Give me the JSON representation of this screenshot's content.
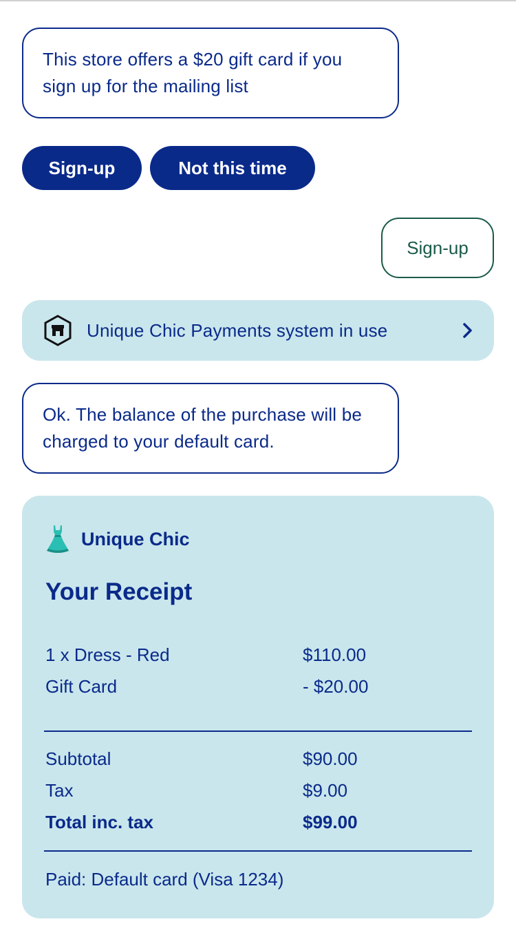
{
  "messages": {
    "offer_text": "This store offers a $20 gift card if you sign up for the mailing list",
    "balance_text": "Ok. The balance of the purchase will be charged to your default card."
  },
  "quick_replies": {
    "signup_label": "Sign-up",
    "decline_label": "Not this time"
  },
  "user_reply": {
    "text": "Sign-up"
  },
  "payment_banner": {
    "text": "Unique Chic Payments system in use",
    "icon": "store-icon"
  },
  "receipt": {
    "merchant_icon": "dress-emoji",
    "merchant_name": "Unique Chic",
    "title": "Your Receipt",
    "items": [
      {
        "label": "1 x Dress - Red",
        "value": "$110.00"
      },
      {
        "label": "Gift Card",
        "value": "- $20.00"
      }
    ],
    "totals": [
      {
        "label": "Subtotal",
        "value": "$90.00"
      },
      {
        "label": "Tax",
        "value": "$9.00"
      },
      {
        "label": "Total inc. tax",
        "value": "$99.00"
      }
    ],
    "paid_text": "Paid: Default card (Visa 1234)"
  },
  "colors": {
    "primary": "#0a2a8a",
    "user_bubble_border": "#1a5a4a",
    "card_background": "#c9e6ec"
  }
}
